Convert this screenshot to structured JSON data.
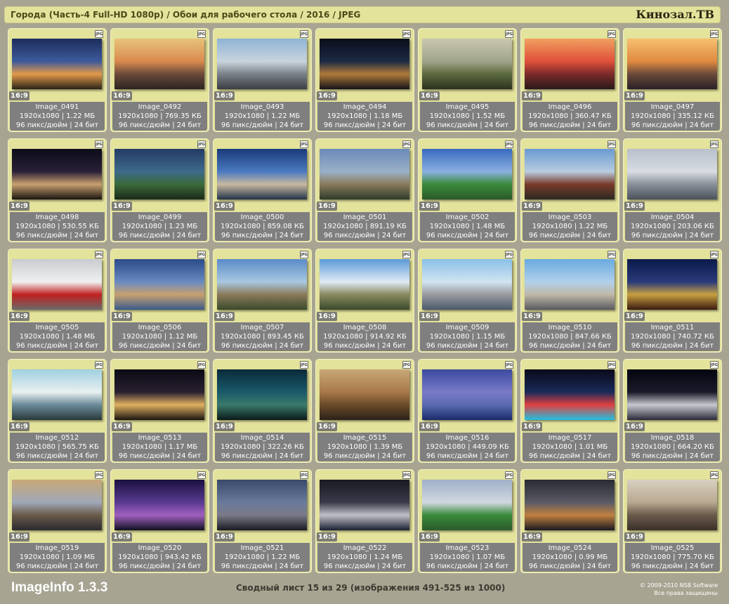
{
  "header": {
    "title": "Города (Часть-4 Full-HD 1080p) / Обои для рабочего стола / 2016 / JPEG",
    "site": "Кинозал.ТВ"
  },
  "file_type_badge": "JPG",
  "items": [
    {
      "name": "Image_0491",
      "dims": "1920x1080 | 1.22 МБ",
      "dpi": "96 пикс/дюйм | 24 бит",
      "ratio": "16:9"
    },
    {
      "name": "Image_0492",
      "dims": "1920x1080 | 769.35 КБ",
      "dpi": "96 пикс/дюйм | 24 бит",
      "ratio": "16:9"
    },
    {
      "name": "Image_0493",
      "dims": "1920x1080 | 1.22 МБ",
      "dpi": "96 пикс/дюйм | 24 бит",
      "ratio": "16:9"
    },
    {
      "name": "Image_0494",
      "dims": "1920x1080 | 1.18 МБ",
      "dpi": "96 пикс/дюйм | 24 бит",
      "ratio": "16:9"
    },
    {
      "name": "Image_0495",
      "dims": "1920x1080 | 1.52 МБ",
      "dpi": "96 пикс/дюйм | 24 бит",
      "ratio": "16:9"
    },
    {
      "name": "Image_0496",
      "dims": "1920x1080 | 360.47 КБ",
      "dpi": "96 пикс/дюйм | 24 бит",
      "ratio": "16:9"
    },
    {
      "name": "Image_0497",
      "dims": "1920x1080 | 335.12 КБ",
      "dpi": "96 пикс/дюйм | 24 бит",
      "ratio": "16:9"
    },
    {
      "name": "Image_0498",
      "dims": "1920x1080 | 530.55 КБ",
      "dpi": "96 пикс/дюйм | 24 бит",
      "ratio": "16:9"
    },
    {
      "name": "Image_0499",
      "dims": "1920x1080 | 1.23 МБ",
      "dpi": "96 пикс/дюйм | 24 бит",
      "ratio": "16:9"
    },
    {
      "name": "Image_0500",
      "dims": "1920x1080 | 859.08 КБ",
      "dpi": "96 пикс/дюйм | 24 бит",
      "ratio": "16:9"
    },
    {
      "name": "Image_0501",
      "dims": "1920x1080 | 891.19 КБ",
      "dpi": "96 пикс/дюйм | 24 бит",
      "ratio": "16:9"
    },
    {
      "name": "Image_0502",
      "dims": "1920x1080 | 1.48 МБ",
      "dpi": "96 пикс/дюйм | 24 бит",
      "ratio": "16:9"
    },
    {
      "name": "Image_0503",
      "dims": "1920x1080 | 1.22 МБ",
      "dpi": "96 пикс/дюйм | 24 бит",
      "ratio": "16:9"
    },
    {
      "name": "Image_0504",
      "dims": "1920x1080 | 203.06 КБ",
      "dpi": "96 пикс/дюйм | 24 бит",
      "ratio": "16:9"
    },
    {
      "name": "Image_0505",
      "dims": "1920x1080 | 1.48 МБ",
      "dpi": "96 пикс/дюйм | 24 бит",
      "ratio": "16:9"
    },
    {
      "name": "Image_0506",
      "dims": "1920x1080 | 1.12 МБ",
      "dpi": "96 пикс/дюйм | 24 бит",
      "ratio": "16:9"
    },
    {
      "name": "Image_0507",
      "dims": "1920x1080 | 893.45 КБ",
      "dpi": "96 пикс/дюйм | 24 бит",
      "ratio": "16:9"
    },
    {
      "name": "Image_0508",
      "dims": "1920x1080 | 914.92 КБ",
      "dpi": "96 пикс/дюйм | 24 бит",
      "ratio": "16:9"
    },
    {
      "name": "Image_0509",
      "dims": "1920x1080 | 1.15 МБ",
      "dpi": "96 пикс/дюйм | 24 бит",
      "ratio": "16:9"
    },
    {
      "name": "Image_0510",
      "dims": "1920x1080 | 847.66 КБ",
      "dpi": "96 пикс/дюйм | 24 бит",
      "ratio": "16:9"
    },
    {
      "name": "Image_0511",
      "dims": "1920x1080 | 740.72 КБ",
      "dpi": "96 пикс/дюйм | 24 бит",
      "ratio": "16:9"
    },
    {
      "name": "Image_0512",
      "dims": "1920x1080 | 565.75 КБ",
      "dpi": "96 пикс/дюйм | 24 бит",
      "ratio": "16:9"
    },
    {
      "name": "Image_0513",
      "dims": "1920x1080 | 1.17 МБ",
      "dpi": "96 пикс/дюйм | 24 бит",
      "ratio": "16:9"
    },
    {
      "name": "Image_0514",
      "dims": "1920x1080 | 322.26 КБ",
      "dpi": "96 пикс/дюйм | 24 бит",
      "ratio": "16:9"
    },
    {
      "name": "Image_0515",
      "dims": "1920x1080 | 1.39 МБ",
      "dpi": "96 пикс/дюйм | 24 бит",
      "ratio": "16:9"
    },
    {
      "name": "Image_0516",
      "dims": "1920x1080 | 449.09 КБ",
      "dpi": "96 пикс/дюйм | 24 бит",
      "ratio": "16:9"
    },
    {
      "name": "Image_0517",
      "dims": "1920x1080 | 1.01 МБ",
      "dpi": "96 пикс/дюйм | 24 бит",
      "ratio": "16:9"
    },
    {
      "name": "Image_0518",
      "dims": "1920x1080 | 664.20 КБ",
      "dpi": "96 пикс/дюйм | 24 бит",
      "ratio": "16:9"
    },
    {
      "name": "Image_0519",
      "dims": "1920x1080 | 1.09 МБ",
      "dpi": "96 пикс/дюйм | 24 бит",
      "ratio": "16:9"
    },
    {
      "name": "Image_0520",
      "dims": "1920x1080 | 943.42 КБ",
      "dpi": "96 пикс/дюйм | 24 бит",
      "ratio": "16:9"
    },
    {
      "name": "Image_0521",
      "dims": "1920x1080 | 1.22 МБ",
      "dpi": "96 пикс/дюйм | 24 бит",
      "ratio": "16:9"
    },
    {
      "name": "Image_0522",
      "dims": "1920x1080 | 1.24 МБ",
      "dpi": "96 пикс/дюйм | 24 бит",
      "ratio": "16:9"
    },
    {
      "name": "Image_0523",
      "dims": "1920x1080 | 1.07 МБ",
      "dpi": "96 пикс/дюйм | 24 бит",
      "ratio": "16:9"
    },
    {
      "name": "Image_0524",
      "dims": "1920x1080 | 0.99 МБ",
      "dpi": "96 пикс/дюйм | 24 бит",
      "ratio": "16:9"
    },
    {
      "name": "Image_0525",
      "dims": "1920x1080 | 775.70 КБ",
      "dpi": "96 пикс/дюйм | 24 бит",
      "ratio": "16:9"
    }
  ],
  "footer": {
    "app": "ImageInfo 1.3.3",
    "sheet": "Сводный лист 15 из 29 (изображения 491-525 из 1000)",
    "copyright_line1": "© 2009-2010 NSB Software",
    "copyright_line2": "Все права защищены"
  },
  "colors": {
    "background": "#a7a492",
    "card": "#e4e39c",
    "info_panel": "#7f7f7f"
  }
}
